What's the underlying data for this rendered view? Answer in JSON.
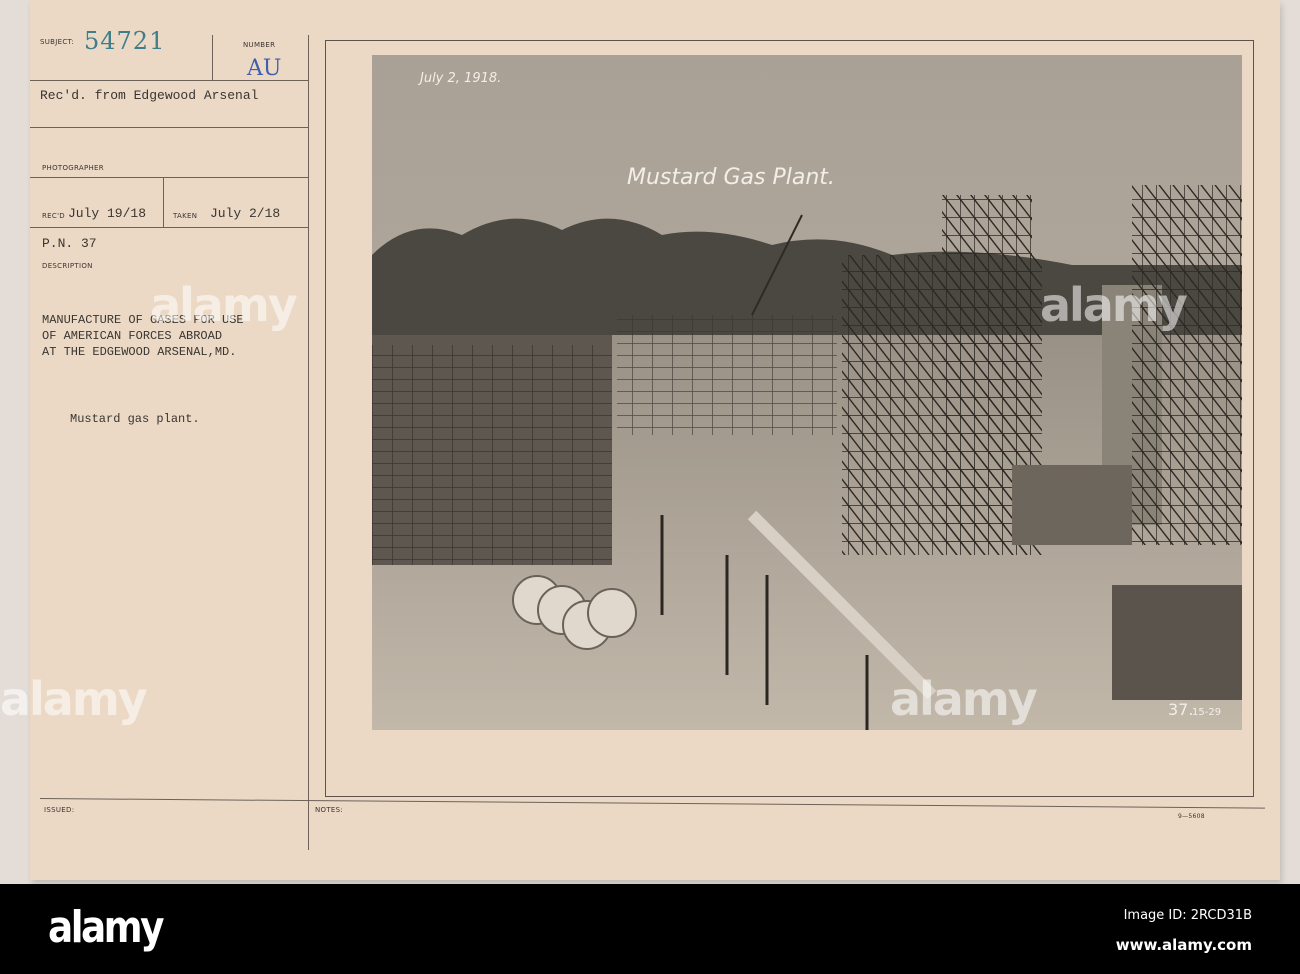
{
  "card": {
    "subject_label": "SUBJECT:",
    "subject_number": "54721",
    "number_label": "NUMBER",
    "number_value": "AU",
    "received_from": "Rec'd. from Edgewood Arsenal",
    "photographer_label": "PHOTOGRAPHER",
    "recd_label": "REC'D",
    "recd_date": "July 19/18",
    "taken_label": "TAKEN",
    "taken_date": "July 2/18",
    "pn": "P.N. 37",
    "description_label": "DESCRIPTION",
    "description_lines": [
      "MANUFACTURE OF GASES FOR USE",
      "OF AMERICAN FORCES ABROAD",
      "AT THE EDGEWOOD ARSENAL,MD."
    ],
    "caption": "Mustard gas plant.",
    "issued_label": "ISSUED:",
    "notes_label": "NOTES:",
    "form_number": "9—5608"
  },
  "photo": {
    "date_annotation": "July 2, 1918.",
    "title_annotation": "Mustard Gas Plant.",
    "plate_number": "37.",
    "plate_code": "15-29"
  },
  "watermark": "alamy",
  "footer": {
    "logo": "alamy",
    "image_id": "Image ID: 2RCD31B",
    "url": "www.alamy.com"
  }
}
